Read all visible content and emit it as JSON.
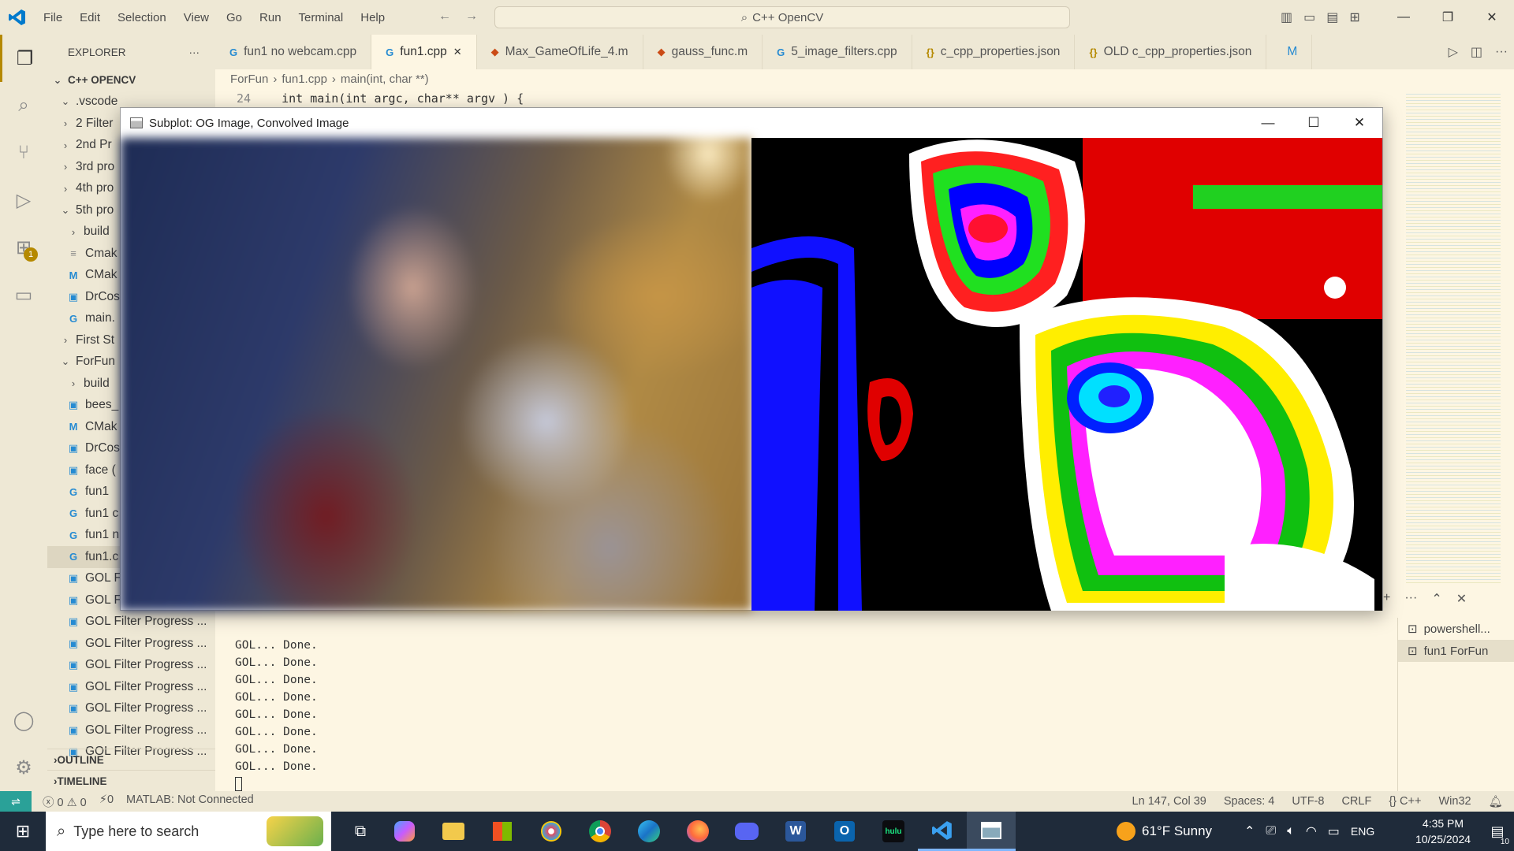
{
  "titlebar": {
    "menu": [
      "File",
      "Edit",
      "Selection",
      "View",
      "Go",
      "Run",
      "Terminal",
      "Help"
    ],
    "search": "C++ OpenCV"
  },
  "explorer": {
    "header": "EXPLORER",
    "root": "C++ OPENCV",
    "items": [
      {
        "label": ".vscode",
        "type": "folder-open",
        "indent": 1
      },
      {
        "label": "2 Filter",
        "type": "folder",
        "indent": 1
      },
      {
        "label": "2nd Pr",
        "type": "folder",
        "indent": 1
      },
      {
        "label": "3rd pro",
        "type": "folder",
        "indent": 1
      },
      {
        "label": "4th pro",
        "type": "folder",
        "indent": 1
      },
      {
        "label": "5th pro",
        "type": "folder-open",
        "indent": 1
      },
      {
        "label": "build",
        "type": "folder",
        "indent": 2
      },
      {
        "label": "Cmak",
        "type": "file-text",
        "indent": 2
      },
      {
        "label": "CMak",
        "type": "file-m",
        "indent": 2
      },
      {
        "label": "DrCos",
        "type": "file-img",
        "indent": 2
      },
      {
        "label": "main.",
        "type": "file-cpp",
        "indent": 2
      },
      {
        "label": "First St",
        "type": "folder",
        "indent": 1
      },
      {
        "label": "ForFun",
        "type": "folder-open",
        "indent": 1
      },
      {
        "label": "build",
        "type": "folder",
        "indent": 2
      },
      {
        "label": "bees_",
        "type": "file-img",
        "indent": 2
      },
      {
        "label": "CMak",
        "type": "file-m",
        "indent": 2
      },
      {
        "label": "DrCos",
        "type": "file-img",
        "indent": 2
      },
      {
        "label": "face (",
        "type": "file-img",
        "indent": 2
      },
      {
        "label": "fun1",
        "type": "file-cpp",
        "indent": 2
      },
      {
        "label": "fun1 c",
        "type": "file-cpp",
        "indent": 2
      },
      {
        "label": "fun1 n",
        "type": "file-cpp",
        "indent": 2
      },
      {
        "label": "fun1.c",
        "type": "file-cpp",
        "indent": 2,
        "selected": true
      },
      {
        "label": "GOL F",
        "type": "file-img",
        "indent": 2
      },
      {
        "label": "GOL F",
        "type": "file-img",
        "indent": 2
      },
      {
        "label": "GOL Filter Progress ...",
        "type": "file-img",
        "indent": 2
      },
      {
        "label": "GOL Filter Progress ...",
        "type": "file-img",
        "indent": 2
      },
      {
        "label": "GOL Filter Progress ...",
        "type": "file-img",
        "indent": 2
      },
      {
        "label": "GOL Filter Progress ...",
        "type": "file-img",
        "indent": 2
      },
      {
        "label": "GOL Filter Progress ...",
        "type": "file-img",
        "indent": 2
      },
      {
        "label": "GOL Filter Progress ...",
        "type": "file-img",
        "indent": 2
      },
      {
        "label": "GOL Filter Progress ...",
        "type": "file-img",
        "indent": 2
      }
    ],
    "outline": "OUTLINE",
    "timeline": "TIMELINE"
  },
  "tabs": [
    {
      "label": "fun1 no webcam.cpp",
      "icon": "G",
      "color": "#268bd2"
    },
    {
      "label": "fun1.cpp",
      "icon": "G",
      "color": "#268bd2",
      "active": true
    },
    {
      "label": "Max_GameOfLife_4.m",
      "icon": "◆",
      "color": "#cb4b16"
    },
    {
      "label": "gauss_func.m",
      "icon": "◆",
      "color": "#cb4b16"
    },
    {
      "label": "5_image_filters.cpp",
      "icon": "G",
      "color": "#268bd2"
    },
    {
      "label": "c_cpp_properties.json",
      "icon": "{}",
      "color": "#b58900"
    },
    {
      "label": "OLD c_cpp_properties.json",
      "icon": "{}",
      "color": "#b58900"
    },
    {
      "label": "M",
      "icon": "",
      "color": "#268bd2"
    }
  ],
  "breadcrumb": [
    "ForFun",
    "fun1.cpp",
    "main(int, char **)"
  ],
  "code": {
    "line_number": "24",
    "text": "int main(int argc, char** argv ) {"
  },
  "cv_window": {
    "title": "Subplot: OG Image, Convolved Image"
  },
  "terminal": {
    "lines": [
      "GOL... Done.",
      "GOL... Done.",
      "GOL... Done.",
      "GOL... Done.",
      "GOL... Done.",
      "GOL... Done.",
      "GOL... Done.",
      "GOL... Done."
    ],
    "sessions": [
      "powershell...",
      "fun1 ForFun"
    ]
  },
  "status": {
    "errors": "0",
    "warnings": "0",
    "ports": "0",
    "matlab": "MATLAB: Not Connected",
    "position": "Ln 147, Col 39",
    "spaces": "Spaces: 4",
    "encoding": "UTF-8",
    "eol": "CRLF",
    "language": "C++",
    "platform": "Win32"
  },
  "taskbar": {
    "search_placeholder": "Type here to search",
    "weather": "61°F  Sunny",
    "lang": "ENG",
    "time": "4:35 PM",
    "date": "10/25/2024",
    "notif_count": "10",
    "apps": [
      "task-view",
      "copilot",
      "file-explorer",
      "store",
      "paint",
      "chrome",
      "edge",
      "firefox",
      "discord",
      "word",
      "outlook",
      "hulu",
      "vscode",
      "opencv-window"
    ]
  }
}
